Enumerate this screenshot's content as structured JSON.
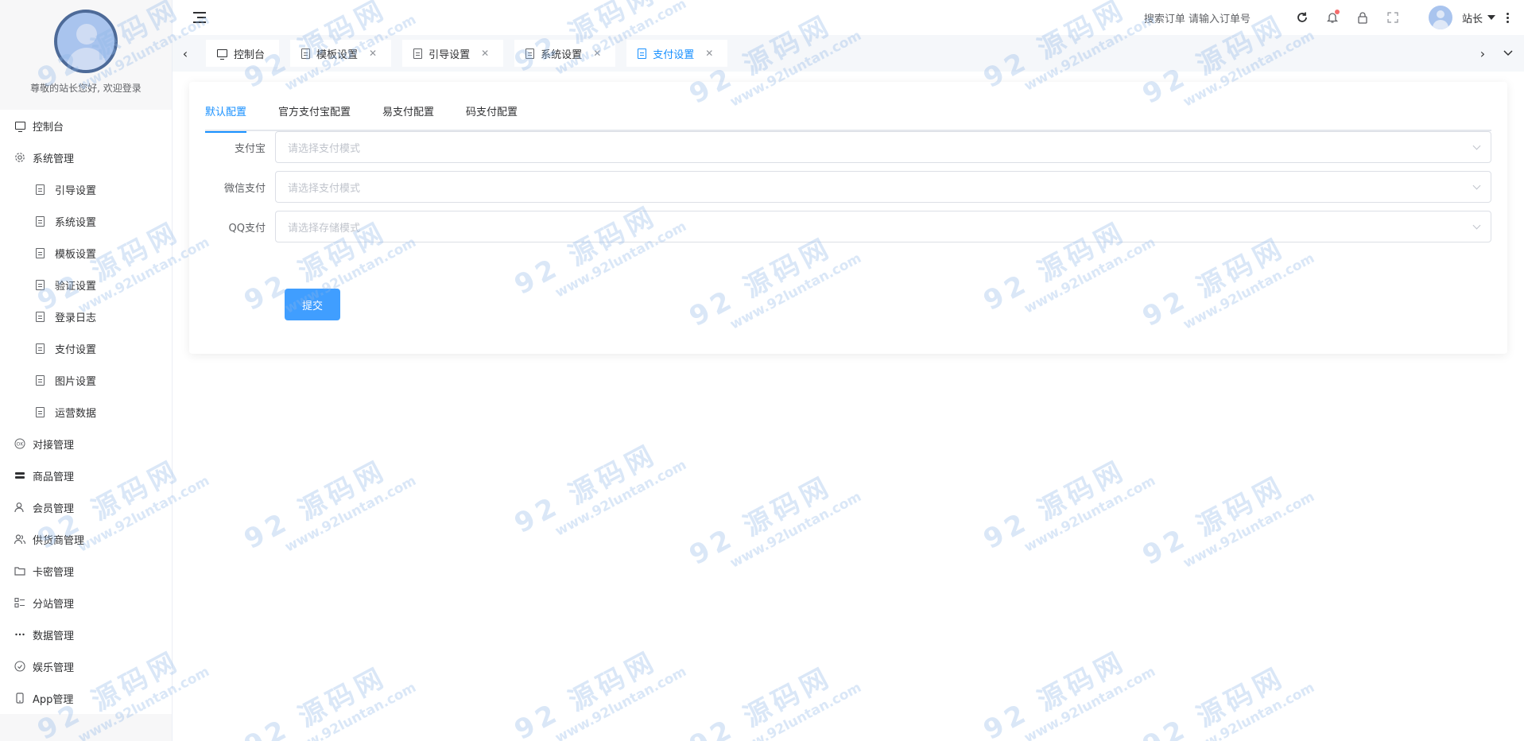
{
  "sidebar": {
    "welcome": "尊敬的站长您好, 欢迎登录",
    "items": [
      {
        "label": "控制台",
        "icon": "monitor-icon",
        "sub": false
      },
      {
        "label": "系统管理",
        "icon": "gear-icon",
        "sub": false
      },
      {
        "label": "引导设置",
        "icon": "document-icon",
        "sub": true
      },
      {
        "label": "系统设置",
        "icon": "document-icon",
        "sub": true
      },
      {
        "label": "模板设置",
        "icon": "document-icon",
        "sub": true
      },
      {
        "label": "验证设置",
        "icon": "document-icon",
        "sub": true
      },
      {
        "label": "登录日志",
        "icon": "document-icon",
        "sub": true
      },
      {
        "label": "支付设置",
        "icon": "document-icon",
        "sub": true
      },
      {
        "label": "图片设置",
        "icon": "document-icon",
        "sub": true
      },
      {
        "label": "运营数据",
        "icon": "document-icon",
        "sub": true
      },
      {
        "label": "对接管理",
        "icon": "ok-icon",
        "sub": false
      },
      {
        "label": "商品管理",
        "icon": "stack-icon",
        "sub": false
      },
      {
        "label": "会员管理",
        "icon": "user-icon",
        "sub": false
      },
      {
        "label": "供货商管理",
        "icon": "users-icon",
        "sub": false
      },
      {
        "label": "卡密管理",
        "icon": "folder-icon",
        "sub": false
      },
      {
        "label": "分站管理",
        "icon": "list-icon",
        "sub": false
      },
      {
        "label": "数据管理",
        "icon": "dots-icon",
        "sub": false
      },
      {
        "label": "娱乐管理",
        "icon": "game-icon",
        "sub": false
      },
      {
        "label": "App管理",
        "icon": "phone-icon",
        "sub": false
      }
    ]
  },
  "topbar": {
    "search_label": "搜索订单",
    "search_placeholder": "请输入订单号",
    "user_name": "站长"
  },
  "tabs": [
    {
      "label": "控制台",
      "icon": "monitor-icon",
      "closable": false,
      "active": false
    },
    {
      "label": "模板设置",
      "icon": "document-icon",
      "closable": true,
      "active": false
    },
    {
      "label": "引导设置",
      "icon": "document-icon",
      "closable": true,
      "active": false
    },
    {
      "label": "系统设置",
      "icon": "document-icon",
      "closable": true,
      "active": false
    },
    {
      "label": "支付设置",
      "icon": "document-icon",
      "closable": true,
      "active": true
    }
  ],
  "content_tabs": [
    {
      "label": "默认配置",
      "active": true
    },
    {
      "label": "官方支付宝配置",
      "active": false
    },
    {
      "label": "易支付配置",
      "active": false
    },
    {
      "label": "码支付配置",
      "active": false
    }
  ],
  "form": {
    "fields": [
      {
        "label": "支付宝",
        "placeholder": "请选择支付模式"
      },
      {
        "label": "微信支付",
        "placeholder": "请选择支付模式"
      },
      {
        "label": "QQ支付",
        "placeholder": "请选择存储模式"
      }
    ],
    "submit_label": "提交"
  },
  "watermark": {
    "big": "92 源码网",
    "small": "www.92luntan.com"
  },
  "colors": {
    "accent": "#1890ff",
    "button": "#409eff"
  }
}
